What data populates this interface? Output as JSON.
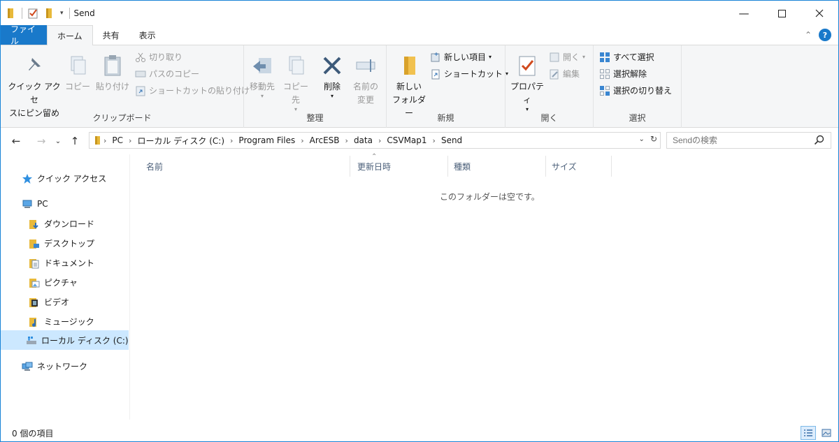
{
  "window": {
    "title": "Send"
  },
  "ribbon_tabs": {
    "file": "ファイル",
    "home": "ホーム",
    "share": "共有",
    "view": "表示"
  },
  "clipboard": {
    "pin": "クイック アクセ",
    "pin2": "スにピン留め",
    "copy": "コピー",
    "paste": "貼り付け",
    "cut": "切り取り",
    "copy_path": "パスのコピー",
    "paste_shortcut": "ショートカットの貼り付け",
    "label": "クリップボード"
  },
  "organize": {
    "move_to": "移動先",
    "copy_to": "コピー先",
    "delete": "削除",
    "rename1": "名前の",
    "rename2": "変更",
    "label": "整理"
  },
  "new": {
    "new_folder1": "新しい",
    "new_folder2": "フォルダー",
    "new_item": "新しい項目",
    "shortcut": "ショートカット",
    "label": "新規"
  },
  "open": {
    "properties": "プロパティ",
    "open": "開く",
    "edit": "編集",
    "label": "開く"
  },
  "select": {
    "select_all": "すべて選択",
    "select_none": "選択解除",
    "invert": "選択の切り替え",
    "label": "選択"
  },
  "address": {
    "crumbs": [
      "PC",
      "ローカル ディスク (C:)",
      "Program Files",
      "ArcESB",
      "data",
      "CSVMap1",
      "Send"
    ]
  },
  "search": {
    "placeholder": "Sendの検索"
  },
  "nav": {
    "quick_access": "クイック アクセス",
    "pc": "PC",
    "downloads": "ダウンロード",
    "desktop": "デスクトップ",
    "documents": "ドキュメント",
    "pictures": "ピクチャ",
    "videos": "ビデオ",
    "music": "ミュージック",
    "local_disk": "ローカル ディスク (C:)",
    "network": "ネットワーク"
  },
  "columns": {
    "name": "名前",
    "modified": "更新日時",
    "type": "種類",
    "size": "サイズ"
  },
  "empty_message": "このフォルダーは空です。",
  "status": {
    "count": "0 個の項目"
  },
  "colors": {
    "accent": "#1979ca",
    "selected": "#cce8ff"
  }
}
